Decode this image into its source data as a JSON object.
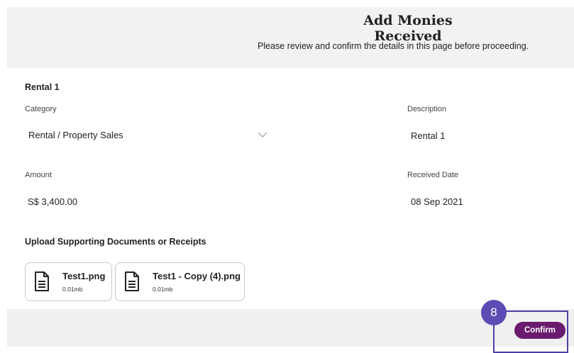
{
  "header": {
    "title": "Add Monies Received",
    "subtitle": "Please review and confirm the details in this page before proceeding."
  },
  "form": {
    "section_title": "Rental 1",
    "category": {
      "label": "Category",
      "value": "Rental / Property Sales"
    },
    "description": {
      "label": "Description",
      "value": "Rental 1"
    },
    "amount": {
      "label": "Amount",
      "value": "S$ 3,400.00"
    },
    "received_date": {
      "label": "Received Date",
      "value": "08 Sep 2021"
    }
  },
  "upload": {
    "title": "Upload Supporting Documents or Receipts",
    "files": [
      {
        "name": "Test1.png",
        "size": "0.01mb"
      },
      {
        "name": "Test1 - Copy (4).png",
        "size": "0.01mb"
      }
    ]
  },
  "footer": {
    "confirm_label": "Confirm",
    "step_number": "8",
    "accent_color": "#6a1b6e",
    "highlight_color": "#4b3fa8"
  }
}
